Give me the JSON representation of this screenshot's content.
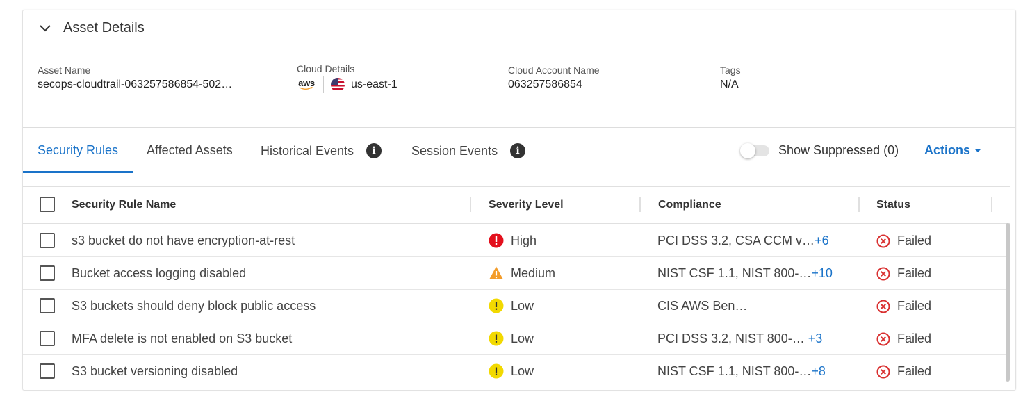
{
  "section": {
    "title": "Asset Details"
  },
  "asset": {
    "name_label": "Asset Name",
    "name_value": "secops-cloudtrail-063257586854-502…",
    "cloud_label": "Cloud Details",
    "cloud_provider": "aws",
    "region": "us-east-1",
    "account_label": "Cloud Account Name",
    "account_value": "063257586854",
    "tags_label": "Tags",
    "tags_value": "N/A"
  },
  "tabs": [
    {
      "label": "Security Rules",
      "active": true
    },
    {
      "label": "Affected Assets"
    },
    {
      "label": "Historical Events"
    },
    {
      "label": "Session Events"
    }
  ],
  "toolbar": {
    "show_suppressed": "Show Suppressed (0)",
    "actions": "Actions"
  },
  "table": {
    "headers": [
      "Security Rule Name",
      "Severity Level",
      "Compliance",
      "Status"
    ],
    "rows": [
      {
        "name": "s3 bucket do not have encryption-at-rest",
        "severity": "High",
        "compliance": "PCI DSS 3.2, CSA CCM v…",
        "extra": "+6",
        "status": "Failed"
      },
      {
        "name": "Bucket access logging disabled",
        "severity": "Medium",
        "compliance": "NIST CSF 1.1, NIST 800-…",
        "extra": "+10",
        "status": "Failed"
      },
      {
        "name": "S3 buckets should deny block public access",
        "severity": "Low",
        "compliance": "CIS AWS Ben…",
        "extra": "",
        "status": "Failed"
      },
      {
        "name": "MFA delete is not enabled on S3 bucket",
        "severity": "Low",
        "compliance": "PCI DSS 3.2, NIST 800-… ",
        "extra": "+3",
        "status": "Failed"
      },
      {
        "name": "S3 bucket versioning disabled",
        "severity": "Low",
        "compliance": "NIST CSF 1.1, NIST 800-…",
        "extra": "+8",
        "status": "Failed"
      }
    ]
  },
  "colors": {
    "accent": "#1a73c9",
    "high": "#e3101d",
    "medium": "#f39c2a",
    "low": "#f2d900",
    "failed": "#d93030"
  }
}
